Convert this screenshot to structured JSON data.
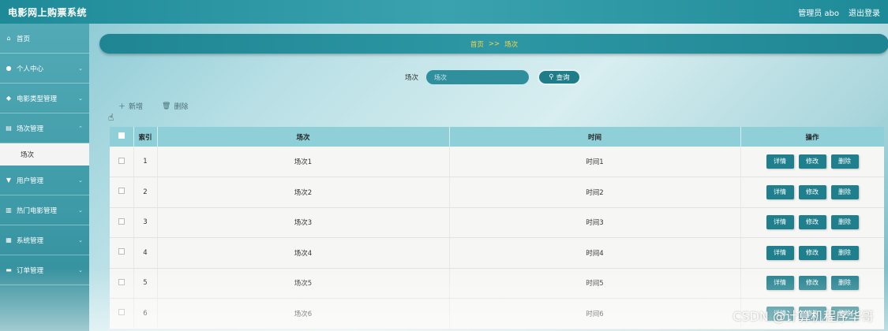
{
  "header": {
    "title": "电影网上购票系统",
    "user_label": "管理员 abo",
    "logout_label": "退出登录"
  },
  "sidebar": {
    "items": [
      {
        "label": "首页",
        "icon": "home-icon"
      },
      {
        "label": "个人中心",
        "icon": "user-icon"
      },
      {
        "label": "电影类型管理",
        "icon": "pin-icon"
      },
      {
        "label": "场次管理",
        "icon": "list-icon"
      },
      {
        "label": "用户管理",
        "icon": "users-icon"
      },
      {
        "label": "热门电影管理",
        "icon": "chart-icon"
      },
      {
        "label": "系统管理",
        "icon": "grid-icon"
      },
      {
        "label": "订单管理",
        "icon": "cart-icon"
      }
    ],
    "active_sub": "场次"
  },
  "breadcrumb": {
    "home": "首页",
    "sep": ">>",
    "current": "场次"
  },
  "search": {
    "label": "场次",
    "placeholder": "场次",
    "button_label": "查询"
  },
  "actions": {
    "add_label": "新增",
    "delete_label": "删除"
  },
  "table": {
    "headers": [
      "索引",
      "场次",
      "时间",
      "操作"
    ],
    "rows": [
      {
        "index": "1",
        "session": "场次1",
        "time": "时间1"
      },
      {
        "index": "2",
        "session": "场次2",
        "time": "时间2"
      },
      {
        "index": "3",
        "session": "场次3",
        "time": "时间3"
      },
      {
        "index": "4",
        "session": "场次4",
        "time": "时间4"
      },
      {
        "index": "5",
        "session": "场次5",
        "time": "时间5"
      },
      {
        "index": "6",
        "session": "场次6",
        "time": "时间6"
      }
    ],
    "op_labels": {
      "detail": "详情",
      "edit": "修改",
      "delete": "删除"
    }
  },
  "watermark": "CSDN @计算机程序华哥",
  "colors": {
    "primary": "#1f8593",
    "breadcrumb_text": "#f3d54a",
    "header_row": "#8fcfd7"
  }
}
